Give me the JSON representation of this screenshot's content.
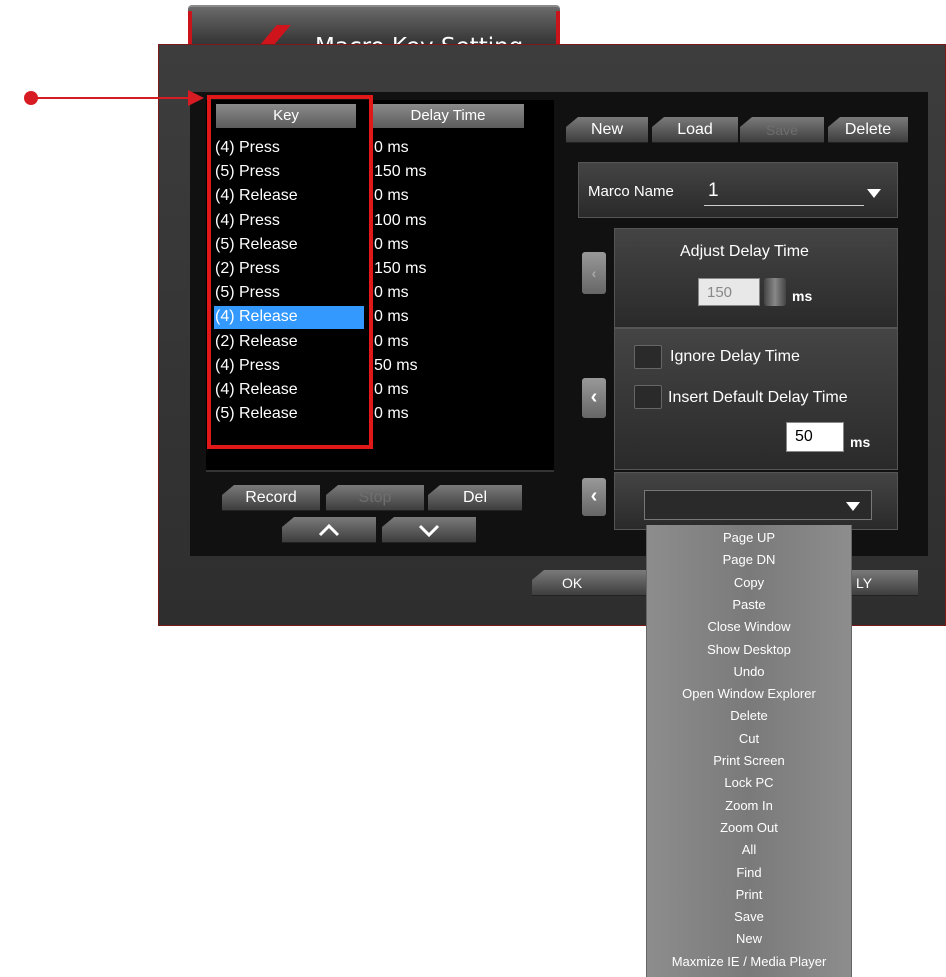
{
  "title": "Macro Key Setting",
  "list": {
    "headers": {
      "key": "Key",
      "delay": "Delay Time"
    },
    "rows": [
      {
        "key": "(4) Press",
        "delay": "0 ms"
      },
      {
        "key": "(5) Press",
        "delay": "150 ms"
      },
      {
        "key": "(4) Release",
        "delay": "0 ms"
      },
      {
        "key": "(4) Press",
        "delay": "100 ms"
      },
      {
        "key": "(5) Release",
        "delay": "0 ms"
      },
      {
        "key": "(2) Press",
        "delay": "150 ms"
      },
      {
        "key": "(5) Press",
        "delay": "0 ms"
      },
      {
        "key": "(4) Release",
        "delay": "0 ms"
      },
      {
        "key": "(2) Release",
        "delay": "0 ms"
      },
      {
        "key": "(4) Press",
        "delay": "50 ms"
      },
      {
        "key": "(4) Release",
        "delay": "0 ms"
      },
      {
        "key": "(5) Release",
        "delay": "0 ms"
      }
    ],
    "selected_index": 7
  },
  "record_controls": {
    "record": "Record",
    "stop": "Stop",
    "del": "Del",
    "up": "^",
    "down": "v"
  },
  "toolbar": {
    "new": "New",
    "load": "Load",
    "save": "Save",
    "delete": "Delete"
  },
  "macro_name": {
    "label": "Marco Name",
    "value": "1"
  },
  "adjust_delay": {
    "title": "Adjust Delay Time",
    "value": "150",
    "unit": "ms"
  },
  "delay_options": {
    "ignore_label": "Ignore Delay Time",
    "insert_label": "Insert Default Delay Time",
    "default_value": "50",
    "unit": "ms"
  },
  "dialog_buttons": {
    "ok": "OK",
    "apply": "LY"
  },
  "dropdown_items": [
    "Page UP",
    "Page DN",
    "Copy",
    "Paste",
    "Close Window",
    "Show Desktop",
    "Undo",
    "Open Window Explorer",
    "Delete",
    "Cut",
    "Print Screen",
    "Lock PC",
    "Zoom In",
    "Zoom Out",
    "All",
    "Find",
    "Print",
    "Save",
    "New",
    "Maxmize IE / Media Player"
  ],
  "colors": {
    "accent_red": "#e01818",
    "selection_blue": "#3399ff"
  }
}
